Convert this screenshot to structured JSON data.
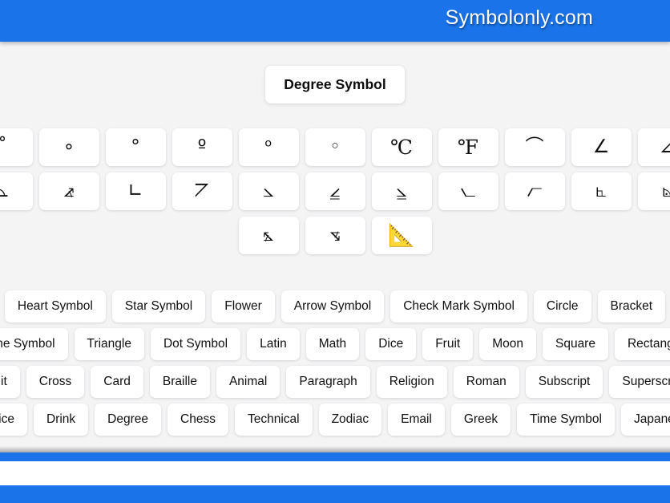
{
  "header": {
    "site_title": "Symbolonly.com",
    "background_color": "#1a73e8",
    "text_color": "#ffffff"
  },
  "heading": {
    "title": "Degree Symbol"
  },
  "symbol_rows": [
    {
      "tiles": [
        {
          "glyph": "˚",
          "name": "ring-above-symbol",
          "style": "plain"
        },
        {
          "glyph": "∘",
          "name": "ring-operator-symbol",
          "style": "plain"
        },
        {
          "glyph": "°",
          "name": "degree-sign-symbol",
          "style": "plain"
        },
        {
          "glyph": "º",
          "name": "masculine-ordinal-symbol",
          "style": "plain"
        },
        {
          "glyph": "ᵒ",
          "name": "modifier-letter-small-o-symbol",
          "style": "plain"
        },
        {
          "glyph": "◦",
          "name": "white-bullet-symbol",
          "style": "plain"
        },
        {
          "glyph": "℃",
          "name": "degree-celsius-symbol",
          "style": "serifed"
        },
        {
          "glyph": "℉",
          "name": "degree-fahrenheit-symbol",
          "style": "serifed"
        },
        {
          "glyph": "⌒",
          "name": "arc-symbol",
          "style": "plain"
        },
        {
          "glyph": "∠",
          "name": "angle-symbol",
          "style": "plain"
        },
        {
          "glyph": "⦞",
          "name": "angle-with-underbar-symbol",
          "style": "plain"
        }
      ]
    },
    {
      "tiles": [
        {
          "glyph": "⊾",
          "name": "right-angle-with-arc-symbol",
          "style": "plain"
        },
        {
          "glyph": "⦨",
          "name": "measured-angle-opening-left-symbol",
          "style": "plain"
        },
        {
          "glyph": "∟",
          "name": "right-angle-symbol",
          "style": "plain"
        },
        {
          "glyph": "⦢",
          "name": "turned-angle-symbol",
          "style": "plain"
        },
        {
          "glyph": "⦣",
          "name": "reversed-angle-symbol",
          "style": "plain"
        },
        {
          "glyph": "⦤",
          "name": "angle-with-s-inside-symbol",
          "style": "plain"
        },
        {
          "glyph": "⦥",
          "name": "acute-angle-symbol",
          "style": "plain"
        },
        {
          "glyph": "⦦",
          "name": "spherical-angle-opening-left-symbol",
          "style": "plain"
        },
        {
          "glyph": "⦧",
          "name": "spherical-angle-opening-up-symbol",
          "style": "plain"
        },
        {
          "glyph": "⦜",
          "name": "right-angle-variant-symbol",
          "style": "plain"
        },
        {
          "glyph": "⦝",
          "name": "measured-right-angle-symbol",
          "style": "plain"
        }
      ]
    },
    {
      "tiles": [
        {
          "glyph": "⦩",
          "name": "measured-angle-opening-right-symbol",
          "style": "plain"
        },
        {
          "glyph": "⦪",
          "name": "angle-opening-down-symbol",
          "style": "plain"
        },
        {
          "glyph": "📐",
          "name": "triangular-ruler-emoji",
          "style": "emoji"
        }
      ]
    }
  ],
  "categories": [
    {
      "items": [
        "Heart Symbol",
        "Star Symbol",
        "Flower",
        "Arrow Symbol",
        "Check Mark Symbol",
        "Circle",
        "Bracket"
      ]
    },
    {
      "items": [
        "Line Symbol",
        "Triangle",
        "Dot Symbol",
        "Latin",
        "Math",
        "Dice",
        "Fruit",
        "Moon",
        "Square",
        "Rectangle"
      ]
    },
    {
      "items": [
        "Unit",
        "Cross",
        "Card",
        "Braille",
        "Animal",
        "Paragraph",
        "Religion",
        "Roman",
        "Subscript",
        "Superscript"
      ]
    },
    {
      "items": [
        "Office",
        "Drink",
        "Degree",
        "Chess",
        "Technical",
        "Zodiac",
        "Email",
        "Greek",
        "Time Symbol",
        "Japanese"
      ]
    }
  ],
  "footer": {
    "bar_color": "#1a73e8"
  }
}
